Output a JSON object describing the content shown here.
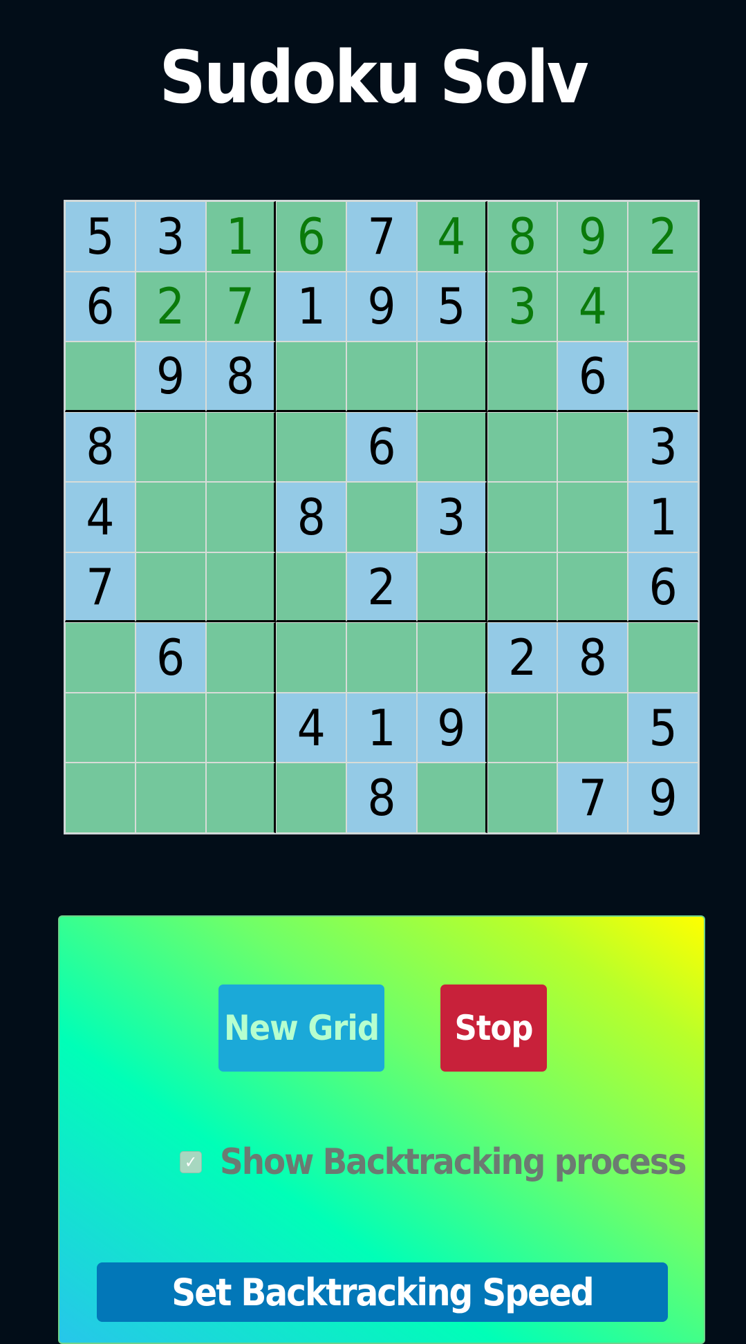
{
  "header": {
    "title": "Sudoku Solv"
  },
  "grid": {
    "rows": [
      [
        {
          "v": "5",
          "t": "given"
        },
        {
          "v": "3",
          "t": "given"
        },
        {
          "v": "1",
          "t": "solved"
        },
        {
          "v": "6",
          "t": "solved"
        },
        {
          "v": "7",
          "t": "given"
        },
        {
          "v": "4",
          "t": "solved"
        },
        {
          "v": "8",
          "t": "solved"
        },
        {
          "v": "9",
          "t": "solved"
        },
        {
          "v": "2",
          "t": "solved"
        }
      ],
      [
        {
          "v": "6",
          "t": "given"
        },
        {
          "v": "2",
          "t": "solved"
        },
        {
          "v": "7",
          "t": "solved"
        },
        {
          "v": "1",
          "t": "given"
        },
        {
          "v": "9",
          "t": "given"
        },
        {
          "v": "5",
          "t": "given"
        },
        {
          "v": "3",
          "t": "solved"
        },
        {
          "v": "4",
          "t": "solved"
        },
        {
          "v": "",
          "t": "empty"
        }
      ],
      [
        {
          "v": "",
          "t": "empty"
        },
        {
          "v": "9",
          "t": "given"
        },
        {
          "v": "8",
          "t": "given"
        },
        {
          "v": "",
          "t": "empty"
        },
        {
          "v": "",
          "t": "empty"
        },
        {
          "v": "",
          "t": "empty"
        },
        {
          "v": "",
          "t": "empty"
        },
        {
          "v": "6",
          "t": "given"
        },
        {
          "v": "",
          "t": "empty"
        }
      ],
      [
        {
          "v": "8",
          "t": "given"
        },
        {
          "v": "",
          "t": "empty"
        },
        {
          "v": "",
          "t": "empty"
        },
        {
          "v": "",
          "t": "empty"
        },
        {
          "v": "6",
          "t": "given"
        },
        {
          "v": "",
          "t": "empty"
        },
        {
          "v": "",
          "t": "empty"
        },
        {
          "v": "",
          "t": "empty"
        },
        {
          "v": "3",
          "t": "given"
        }
      ],
      [
        {
          "v": "4",
          "t": "given"
        },
        {
          "v": "",
          "t": "empty"
        },
        {
          "v": "",
          "t": "empty"
        },
        {
          "v": "8",
          "t": "given"
        },
        {
          "v": "",
          "t": "empty"
        },
        {
          "v": "3",
          "t": "given"
        },
        {
          "v": "",
          "t": "empty"
        },
        {
          "v": "",
          "t": "empty"
        },
        {
          "v": "1",
          "t": "given"
        }
      ],
      [
        {
          "v": "7",
          "t": "given"
        },
        {
          "v": "",
          "t": "empty"
        },
        {
          "v": "",
          "t": "empty"
        },
        {
          "v": "",
          "t": "empty"
        },
        {
          "v": "2",
          "t": "given"
        },
        {
          "v": "",
          "t": "empty"
        },
        {
          "v": "",
          "t": "empty"
        },
        {
          "v": "",
          "t": "empty"
        },
        {
          "v": "6",
          "t": "given"
        }
      ],
      [
        {
          "v": "",
          "t": "empty"
        },
        {
          "v": "6",
          "t": "given"
        },
        {
          "v": "",
          "t": "empty"
        },
        {
          "v": "",
          "t": "empty"
        },
        {
          "v": "",
          "t": "empty"
        },
        {
          "v": "",
          "t": "empty"
        },
        {
          "v": "2",
          "t": "given"
        },
        {
          "v": "8",
          "t": "given"
        },
        {
          "v": "",
          "t": "empty"
        }
      ],
      [
        {
          "v": "",
          "t": "empty"
        },
        {
          "v": "",
          "t": "empty"
        },
        {
          "v": "",
          "t": "empty"
        },
        {
          "v": "4",
          "t": "given"
        },
        {
          "v": "1",
          "t": "given"
        },
        {
          "v": "9",
          "t": "given"
        },
        {
          "v": "",
          "t": "empty"
        },
        {
          "v": "",
          "t": "empty"
        },
        {
          "v": "5",
          "t": "given"
        }
      ],
      [
        {
          "v": "",
          "t": "empty"
        },
        {
          "v": "",
          "t": "empty"
        },
        {
          "v": "",
          "t": "empty"
        },
        {
          "v": "",
          "t": "empty"
        },
        {
          "v": "8",
          "t": "given"
        },
        {
          "v": "",
          "t": "empty"
        },
        {
          "v": "",
          "t": "empty"
        },
        {
          "v": "7",
          "t": "given"
        },
        {
          "v": "9",
          "t": "given"
        }
      ]
    ]
  },
  "controls": {
    "new_grid_label": "New Grid",
    "stop_label": "Stop",
    "show_backtracking_label": "Show Backtracking process",
    "show_backtracking_checked": true,
    "speed_label": "Set Backtracking Speed"
  },
  "colors": {
    "given_cell": "#94cae6",
    "empty_cell": "#74c79c",
    "solved_digit": "#0a7a0a",
    "stop_button": "#c8213a",
    "new_grid_button": "#1ba9d8",
    "speed_bar": "#0277b8"
  },
  "icons": {
    "checkbox": "check-icon"
  }
}
